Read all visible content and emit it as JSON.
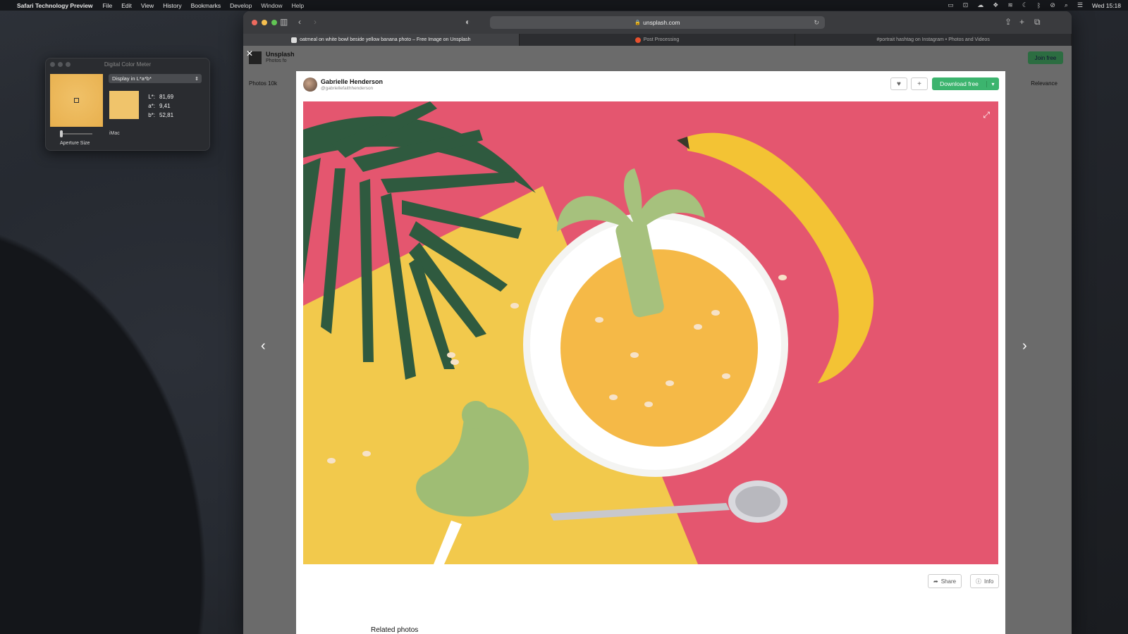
{
  "menubar": {
    "app_name": "Safari Technology Preview",
    "items": [
      "File",
      "Edit",
      "View",
      "History",
      "Bookmarks",
      "Develop",
      "Window",
      "Help"
    ],
    "clock": "Wed 15:18"
  },
  "color_meter": {
    "title": "Digital Color Meter",
    "mode": "Display in L*a*b*",
    "values": [
      {
        "key": "L*:",
        "val": "81,69"
      },
      {
        "key": "a*:",
        "val": "9,41"
      },
      {
        "key": "b*:",
        "val": "52,81"
      }
    ],
    "display_name": "iMac",
    "aperture_label": "Aperture Size",
    "swatch_color": "#f0c46b"
  },
  "browser": {
    "url": "unsplash.com",
    "tabs": [
      {
        "label": "oatmeal on white bowl beside yellow banana photo – Free Image on Unsplash",
        "active": true
      },
      {
        "label": "Post Processing",
        "active": false
      },
      {
        "label": "#portrait hashtag on Instagram • Photos and Videos",
        "active": false
      }
    ]
  },
  "unsplash": {
    "brand": "Unsplash",
    "brand_sub": "Photos fo",
    "photos_tab": "Photos 10k",
    "sort": "Relevance",
    "join": "Join free"
  },
  "modal": {
    "author": "Gabrielle Henderson",
    "handle": "@gabriellefaithhenderson",
    "download_label": "Download free",
    "share_label": "Share",
    "info_label": "Info",
    "related_title": "Related photos"
  },
  "colors": {
    "photo_pink": "#e4566f",
    "photo_yellow": "#f2c94c",
    "download_green": "#3cb46e"
  }
}
